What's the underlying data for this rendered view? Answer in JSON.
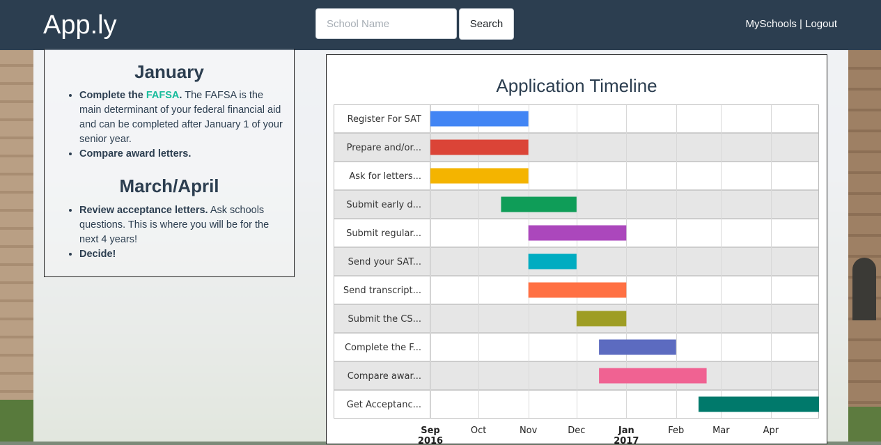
{
  "navbar": {
    "brand": "App.ly",
    "search_placeholder": "School Name",
    "search_button": "Search",
    "link_myschools": "MySchools",
    "separator": "|",
    "link_logout": "Logout"
  },
  "left_panel": {
    "january": {
      "heading": "January",
      "item1_bold": "Complete the",
      "item1_link": "FAFSA",
      "item1_bold_end": ".",
      "item1_text": "The FAFSA is the main determinant of your federal financial aid and can be completed after January 1 of your senior year.",
      "item2_bold": "Compare award letters."
    },
    "march_april": {
      "heading": "March/April",
      "item1_bold": "Review acceptance letters.",
      "item1_text": "Ask schools questions. This is where you will be for the next 4 years!",
      "item2_bold": "Decide!"
    }
  },
  "chart_data": {
    "type": "gantt",
    "title": "Application Timeline",
    "x_range": [
      "2016-09-01",
      "2017-05-01"
    ],
    "x_ticks": [
      {
        "label": "Sep",
        "sublabel": "2016",
        "date": "2016-09-01",
        "bold": true
      },
      {
        "label": "Oct",
        "date": "2016-10-01"
      },
      {
        "label": "Nov",
        "date": "2016-11-01"
      },
      {
        "label": "Dec",
        "date": "2016-12-01"
      },
      {
        "label": "Jan",
        "sublabel": "2017",
        "date": "2017-01-01",
        "bold": true
      },
      {
        "label": "Feb",
        "date": "2017-02-01"
      },
      {
        "label": "Mar",
        "date": "2017-03-01"
      },
      {
        "label": "Apr",
        "date": "2017-04-01"
      }
    ],
    "tasks": [
      {
        "label": "Register For SAT",
        "start": "2016-09-01",
        "end": "2016-11-01",
        "color": "#4285f4"
      },
      {
        "label": "Prepare and/or...",
        "start": "2016-09-01",
        "end": "2016-11-01",
        "color": "#db4437"
      },
      {
        "label": "Ask for letters...",
        "start": "2016-09-01",
        "end": "2016-11-01",
        "color": "#f4b400"
      },
      {
        "label": "Submit early d...",
        "start": "2016-10-15",
        "end": "2016-12-01",
        "color": "#0f9d58"
      },
      {
        "label": "Submit regular...",
        "start": "2016-11-01",
        "end": "2017-01-01",
        "color": "#ab47bc"
      },
      {
        "label": "Send your SAT...",
        "start": "2016-11-01",
        "end": "2016-12-01",
        "color": "#00acc1"
      },
      {
        "label": "Send transcript...",
        "start": "2016-11-01",
        "end": "2017-01-01",
        "color": "#ff7043"
      },
      {
        "label": "Submit the CS...",
        "start": "2016-12-01",
        "end": "2017-01-01",
        "color": "#9e9d24"
      },
      {
        "label": "Complete the F...",
        "start": "2016-12-15",
        "end": "2017-02-01",
        "color": "#5c6bc0"
      },
      {
        "label": "Compare awar...",
        "start": "2016-12-15",
        "end": "2017-02-20",
        "color": "#f06292"
      },
      {
        "label": "Get Acceptanc...",
        "start": "2017-02-15",
        "end": "2017-05-01",
        "color": "#00796b"
      }
    ]
  }
}
